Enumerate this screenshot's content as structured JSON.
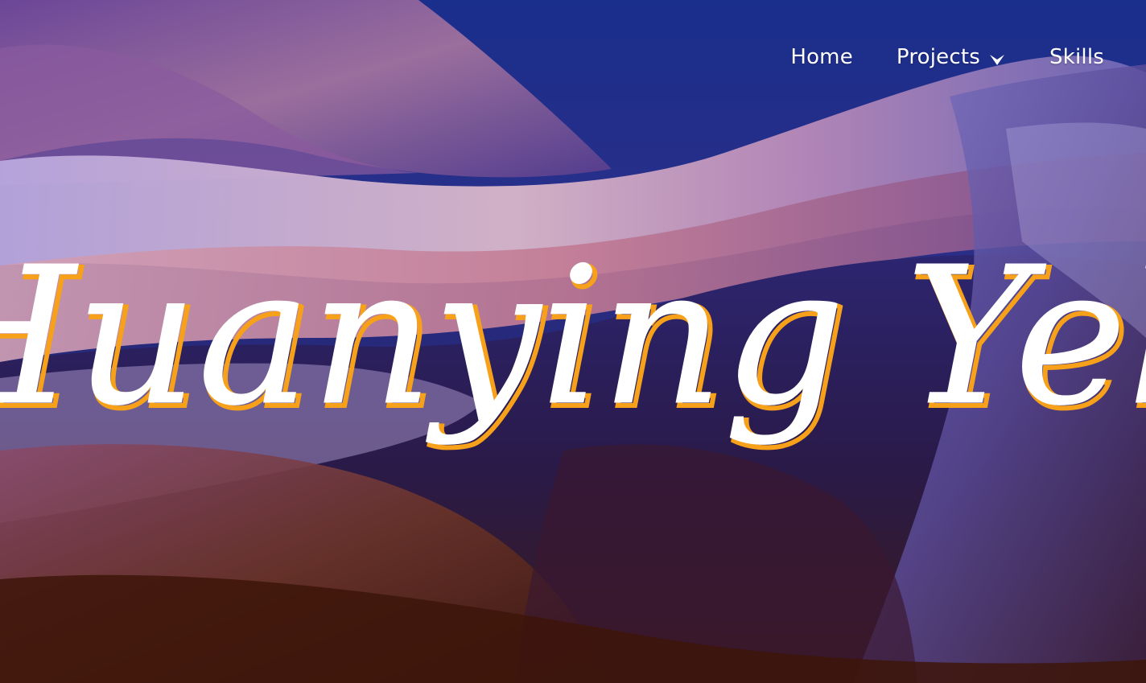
{
  "nav": {
    "items": [
      {
        "label": "Home"
      },
      {
        "label": "Projects"
      },
      {
        "label": "Skills"
      }
    ]
  },
  "hero": {
    "name": "Huanying Yeh"
  },
  "colors": {
    "sky": "#1b2f8a",
    "violet": "#4b3c93",
    "rock_light": "#b9a6d8",
    "rock_rose": "#c07a93",
    "shadow_dark": "#2a1a45",
    "rust": "#5a2616",
    "title_fill": "#ffffff",
    "title_glow": "#f7a11a",
    "nav_text": "#ffffff"
  },
  "icons": {
    "dropdown": "chevron-down-icon"
  }
}
